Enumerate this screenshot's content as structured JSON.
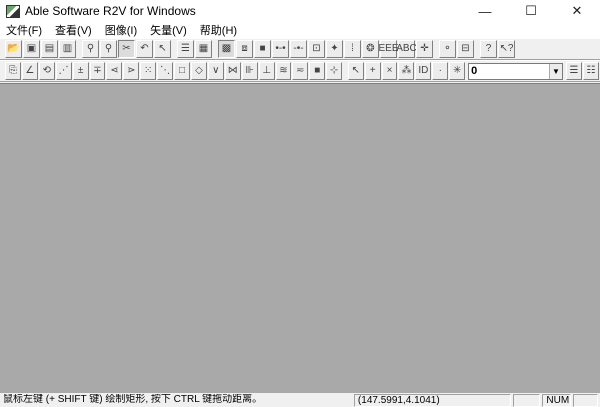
{
  "window": {
    "title": "Able Software R2V for Windows",
    "minimize": "—",
    "maximize": "☐",
    "close": "✕"
  },
  "menu": [
    "文件(F)",
    "查看(V)",
    "图像(I)",
    "矢量(V)",
    "帮助(H)"
  ],
  "toolbar1": [
    [
      {
        "n": "open-icon",
        "g": "📂"
      },
      {
        "n": "save-icon",
        "g": "▣"
      },
      {
        "n": "save-image-icon",
        "g": "▤"
      },
      {
        "n": "save-vector-icon",
        "g": "▥"
      }
    ],
    [
      {
        "n": "zoom-in-icon",
        "g": "⚲"
      },
      {
        "n": "zoom-out-icon",
        "g": "⚲"
      },
      {
        "n": "vectorize-icon",
        "g": "✂",
        "p": true
      },
      {
        "n": "undo-icon",
        "g": "↶"
      },
      {
        "n": "select-icon",
        "g": "↖"
      }
    ],
    [
      {
        "n": "contour-icon",
        "g": "☰"
      },
      {
        "n": "grid-icon",
        "g": "▦"
      }
    ],
    [
      {
        "n": "show-image-icon",
        "g": "▩",
        "p": true
      },
      {
        "n": "frame-icon",
        "g": "⧈"
      },
      {
        "n": "fill-icon",
        "g": "■"
      },
      {
        "n": "line-node-icon",
        "g": "•-•"
      },
      {
        "n": "node-icon",
        "g": "-•-"
      },
      {
        "n": "node-tag-icon",
        "g": "⊡"
      },
      {
        "n": "point-icon",
        "g": "✦"
      },
      {
        "n": "vertical-node-icon",
        "g": "⁞"
      },
      {
        "n": "polygon-icon",
        "g": "❂"
      },
      {
        "n": "text-icon",
        "g": "EEE"
      },
      {
        "n": "abc-icon",
        "g": "ABC"
      },
      {
        "n": "cross-icon",
        "g": "✛"
      }
    ],
    [
      {
        "n": "select-node-icon",
        "g": "⚬"
      },
      {
        "n": "select-box-icon",
        "g": "⊟"
      }
    ],
    [
      {
        "n": "help-icon",
        "g": "?"
      },
      {
        "n": "whats-this-icon",
        "g": "↖?"
      }
    ]
  ],
  "toolbar2": [
    [
      {
        "n": "edit-icon",
        "g": "⎘"
      },
      {
        "n": "draw-line-icon",
        "g": "∠"
      },
      {
        "n": "lasso-icon",
        "g": "⟲"
      },
      {
        "n": "dash-line-icon",
        "g": "⋰"
      },
      {
        "n": "add-node-icon",
        "g": "±"
      },
      {
        "n": "delete-node-icon",
        "g": "∓"
      },
      {
        "n": "join-icon",
        "g": "⋖"
      },
      {
        "n": "extend-icon",
        "g": "⋗"
      },
      {
        "n": "dots-icon",
        "g": "⁙"
      },
      {
        "n": "diagonal-icon",
        "g": "⋱"
      },
      {
        "n": "rectangle-icon",
        "g": "□"
      },
      {
        "n": "rotate-rect-icon",
        "g": "◇"
      },
      {
        "n": "angle-icon",
        "g": "∨"
      },
      {
        "n": "split-icon",
        "g": "⋈"
      },
      {
        "n": "id-icon",
        "g": "⊪"
      },
      {
        "n": "elevation-icon",
        "g": "⊥"
      },
      {
        "n": "contour-lines-icon",
        "g": "≋"
      },
      {
        "n": "smooth-icon",
        "g": "≂"
      },
      {
        "n": "area-fill-icon",
        "g": "■"
      },
      {
        "n": "center-icon",
        "g": "⊹"
      }
    ],
    [
      {
        "n": "pick-icon",
        "g": "↖"
      },
      {
        "n": "plus-icon",
        "g": "+"
      },
      {
        "n": "x-icon",
        "g": "×"
      },
      {
        "n": "scatter-icon",
        "g": "⁂"
      },
      {
        "n": "id-assign-icon",
        "g": "ID"
      },
      {
        "n": "small-dot-icon",
        "g": "·"
      },
      {
        "n": "spark-icon",
        "g": "✳"
      }
    ]
  ],
  "layer_combo": {
    "value": "0",
    "arrow": "▼"
  },
  "toolbar2_end": [
    {
      "n": "layer-list-icon",
      "g": "☰"
    },
    {
      "n": "layer-props-icon",
      "g": "☷"
    }
  ],
  "status": {
    "message": "鼠标左键 (+ SHIFT 键) 绘制矩形, 按下 CTRL 键拖动距离。",
    "coords": "(147.5991,4.1041)",
    "pane3": "",
    "num": "NUM",
    "pane5": ""
  }
}
